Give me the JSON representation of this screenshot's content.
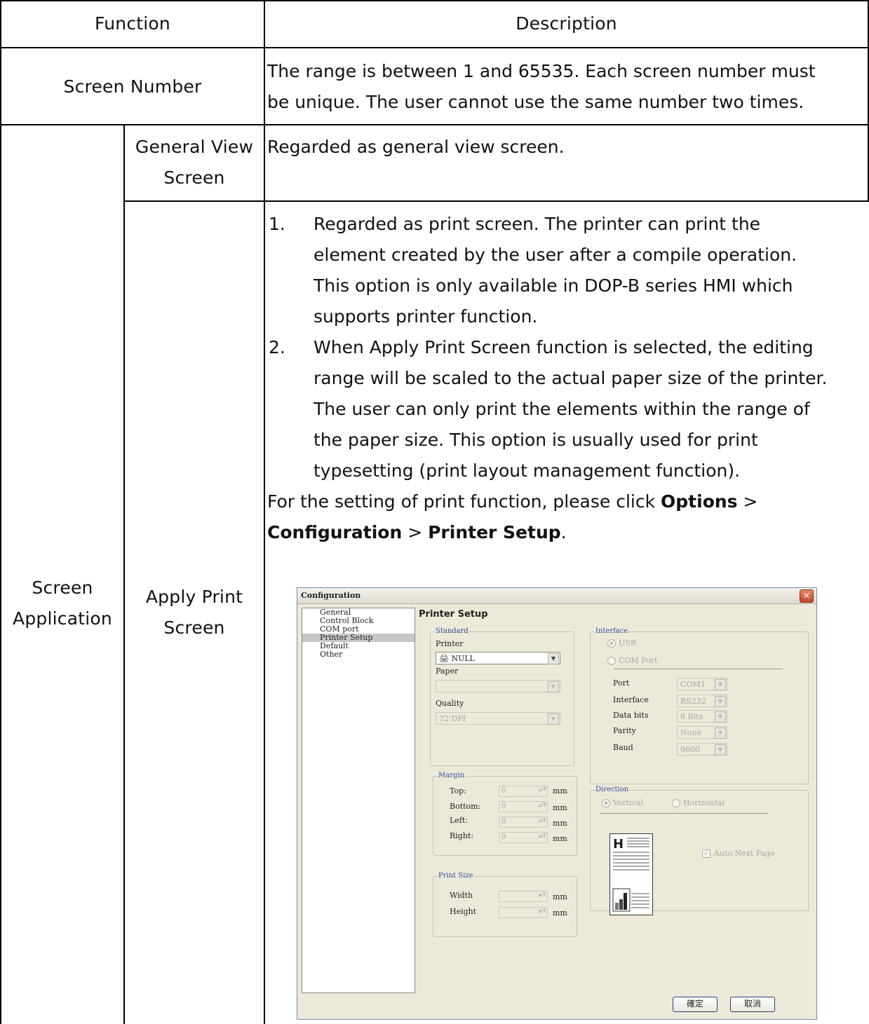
{
  "header": {
    "function": "Function",
    "description": "Description"
  },
  "screen_number": {
    "label": "Screen Number",
    "line1": "The range is between 1 and 65535. Each screen number must",
    "line2": "be unique. The user cannot use the same number two times."
  },
  "screen_application": {
    "label_line1": "Screen",
    "label_line2": "Application",
    "general_view": {
      "label_line1": "General View",
      "label_line2": "Screen",
      "description": "Regarded as general view screen."
    },
    "apply_print": {
      "label_line1": "Apply Print",
      "label_line2": "Screen",
      "item1_num": "1.",
      "item1_lines": [
        "Regarded as print screen. The printer can print the",
        "element created by the user after a compile operation.",
        "This option is only available in DOP-B series HMI which",
        "supports printer function."
      ],
      "item2_num": "2.",
      "item2_lines": [
        "When Apply Print Screen function is selected, the editing",
        "range will be scaled to the actual paper size of the printer.",
        "The user can only print the elements within the range of",
        "the paper size. This option is usually used for print",
        "typesetting (print layout management function)."
      ],
      "note_prefix": "For the setting of print function, please click ",
      "note_opt1": "Options",
      "note_sep1": " >",
      "note_opt2": "Configuration",
      "note_sep2": " > ",
      "note_opt3": "Printer Setup",
      "note_end": "."
    }
  },
  "dialog": {
    "title": "Configuration",
    "tree_items": [
      "General",
      "Control Block",
      "COM port",
      "Printer Setup",
      "Default",
      "Other"
    ],
    "selected_tree_item": "Printer Setup",
    "panel_title": "Printer Setup",
    "standard": {
      "group": "Standard",
      "printer_label": "Printer",
      "printer_value": "NULL",
      "paper_label": "Paper",
      "paper_value": "",
      "quality_label": "Quality",
      "quality_value": "72 DPI"
    },
    "margin": {
      "group": "Margin",
      "top": "Top:",
      "bottom": "Bottom:",
      "left": "Left:",
      "right": "Right:",
      "top_val": "0",
      "bottom_val": "0",
      "left_val": "0",
      "right_val": "0",
      "unit": "mm"
    },
    "print_size": {
      "group": "Print Size",
      "width": "Width",
      "height": "Height",
      "unit": "mm"
    },
    "interface": {
      "group": "Interface",
      "usb": "USB",
      "com_port": "COM Port",
      "port_label": "Port",
      "port_value": "COM1",
      "interface_label": "Interface",
      "interface_value": "RS232",
      "databits_label": "Data bits",
      "databits_value": "8 Bits",
      "parity_label": "Parity",
      "parity_value": "None",
      "baud_label": "Baud",
      "baud_value": "9600"
    },
    "direction": {
      "group": "Direction",
      "vertical": "Vertical",
      "horizontal": "Horizontal",
      "auto_next_page": "Auto Next Page",
      "icon_letter": "H"
    },
    "ok": "確定",
    "cancel": "取消"
  }
}
